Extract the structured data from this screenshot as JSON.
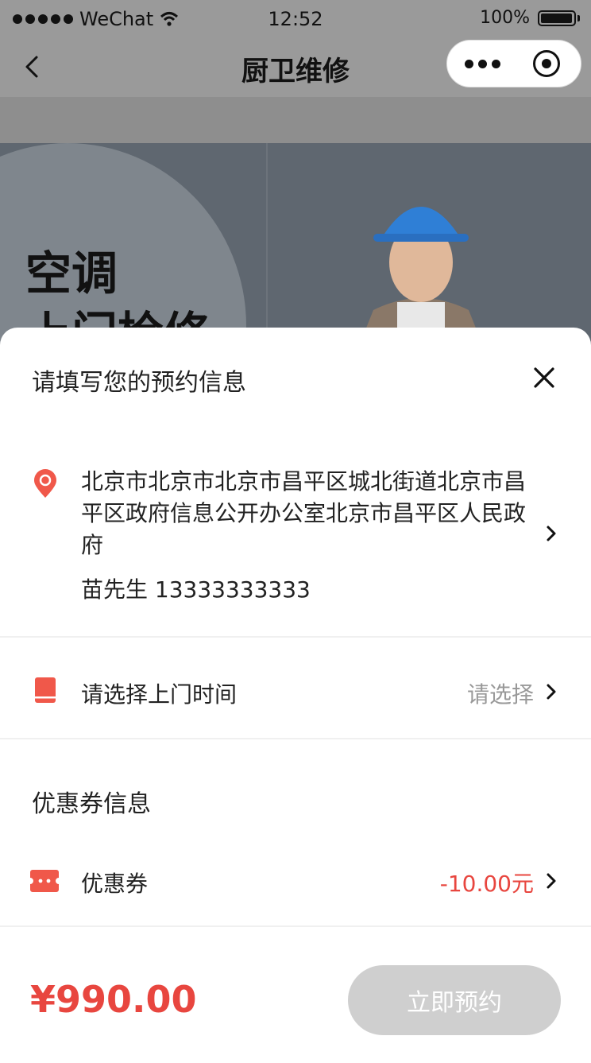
{
  "status_bar": {
    "carrier": "WeChat",
    "time": "12:52",
    "battery": "100%"
  },
  "nav": {
    "title": "厨卫维修"
  },
  "banner": {
    "line1": "空调",
    "line2": "上门检修"
  },
  "sheet": {
    "title": "请填写您的预约信息",
    "address": {
      "text": "北京市北京市北京市昌平区城北街道北京市昌平区政府信息公开办公室北京市昌平区人民政府",
      "contact": "苗先生 13333333333"
    },
    "visit_time": {
      "label": "请选择上门时间",
      "value": "请选择"
    },
    "coupon": {
      "heading": "优惠券信息",
      "label": "优惠券",
      "value": "-10.00元"
    },
    "footer": {
      "price": "¥990.00",
      "button_label": "立即预约"
    }
  },
  "colors": {
    "accent": "#e8463f",
    "button_disabled": "#cfcfcf",
    "overlay": "#9a9a9a"
  },
  "icons": {
    "back": "chevron-left-icon",
    "menu": "more-dots-icon",
    "close_capsule": "target-icon",
    "close_sheet": "close-icon",
    "address": "location-pin-icon",
    "time": "calendar-icon",
    "coupon": "ticket-icon",
    "row_arrow": "chevron-right-icon"
  }
}
